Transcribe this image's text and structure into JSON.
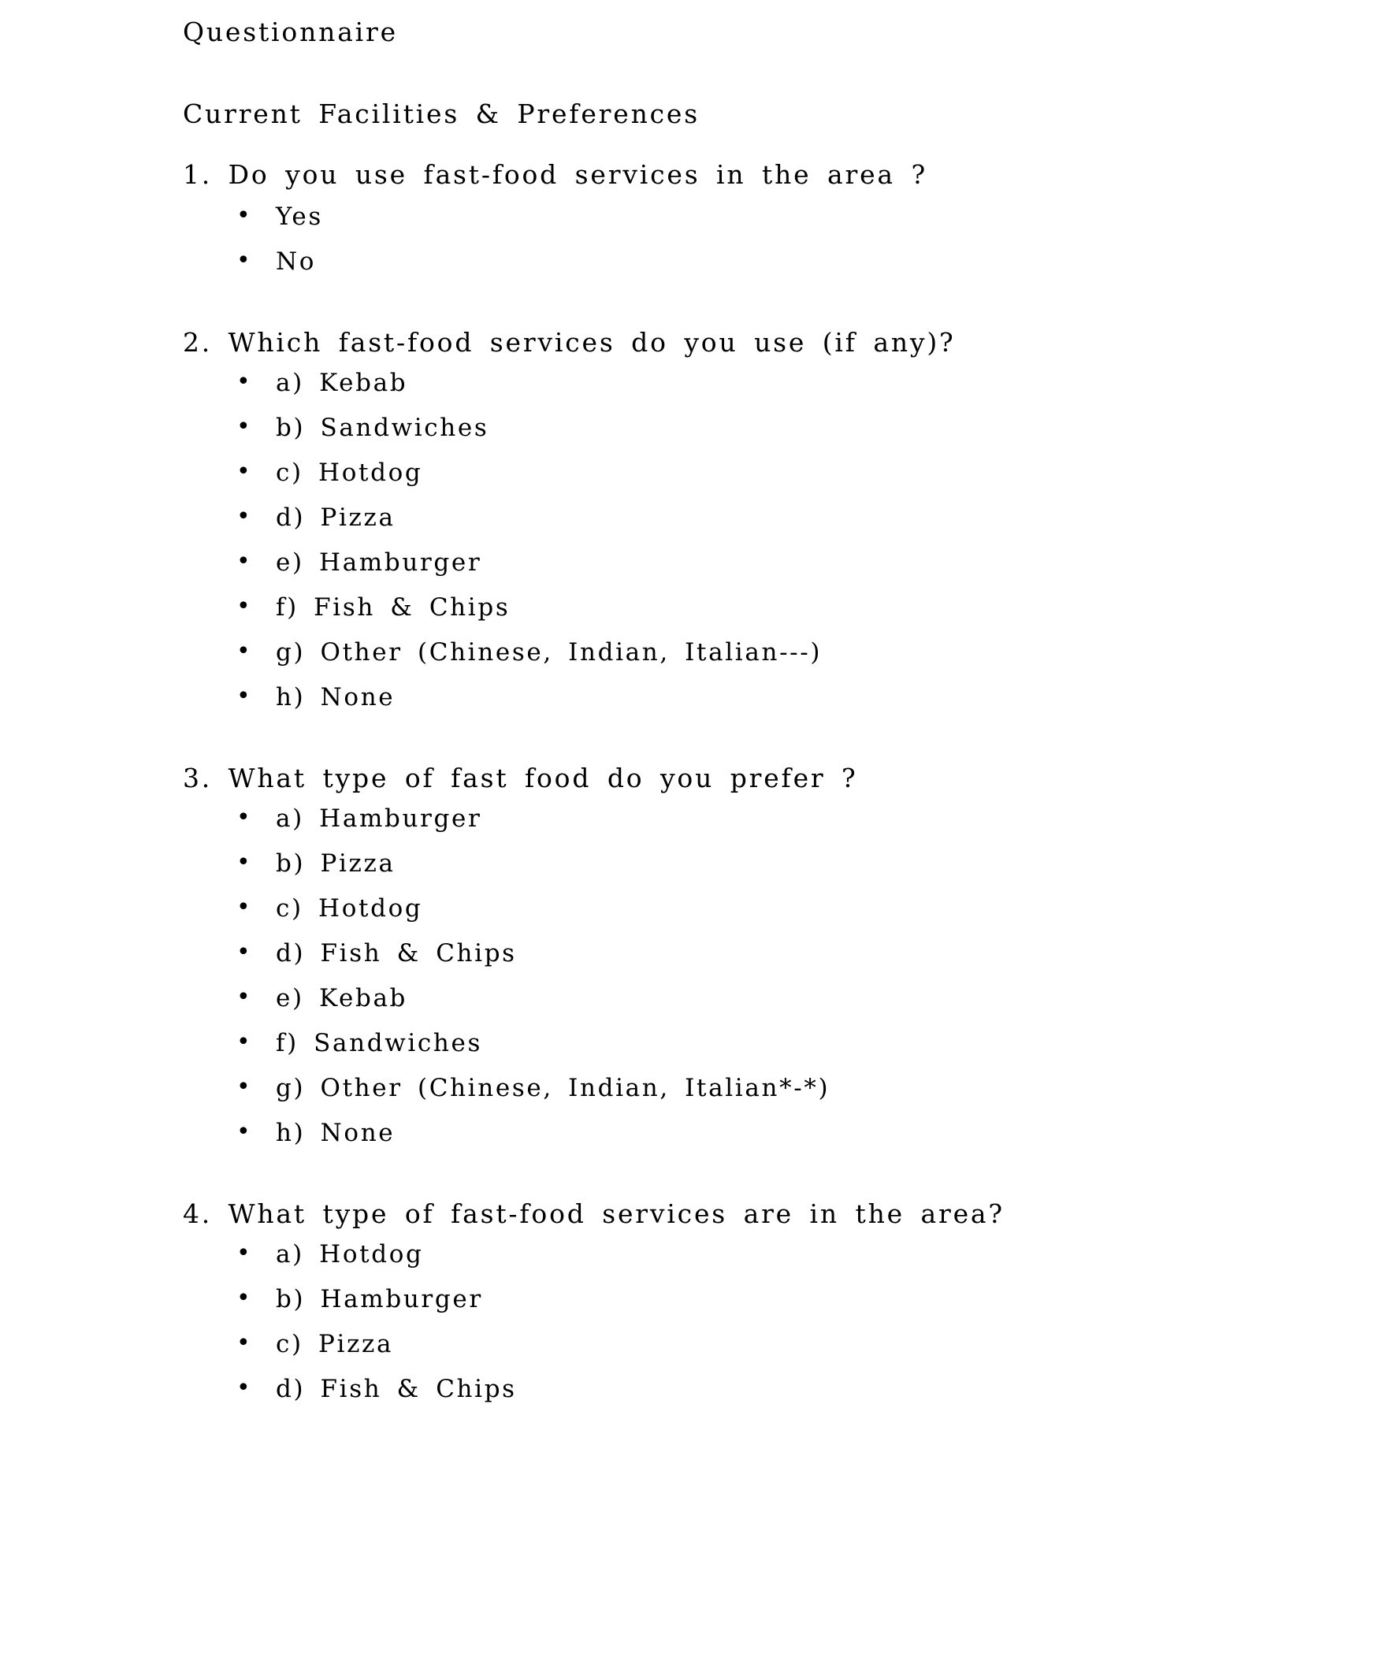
{
  "document": {
    "title": "Questionnaire",
    "section_heading": "Current Facilities & Preferences",
    "bullet_glyph": "•",
    "text_color": "#000000",
    "background_color": "#ffffff"
  },
  "questions": [
    {
      "number": "1.",
      "text": "1. Do you use fast-food services in the area ?",
      "options": [
        {
          "label": "Yes"
        },
        {
          "label": "No"
        }
      ]
    },
    {
      "number": "2.",
      "text": "2. Which fast-food services do you use (if any)?",
      "options": [
        {
          "label": "a) Kebab"
        },
        {
          "label": "b) Sandwiches"
        },
        {
          "label": "c) Hotdog"
        },
        {
          "label": "d) Pizza"
        },
        {
          "label": "e) Hamburger"
        },
        {
          "label": "f) Fish & Chips"
        },
        {
          "label": "g) Other (Chinese, Indian, Italian---)"
        },
        {
          "label": "h) None"
        }
      ]
    },
    {
      "number": "3.",
      "text": "3. What type of fast food do you prefer ?",
      "options": [
        {
          "label": "a) Hamburger"
        },
        {
          "label": "b) Pizza"
        },
        {
          "label": "c) Hotdog"
        },
        {
          "label": "d) Fish & Chips"
        },
        {
          "label": "e) Kebab"
        },
        {
          "label": "f) Sandwiches"
        },
        {
          "label": "g) Other (Chinese, Indian, Italian*-*)"
        },
        {
          "label": "h) None"
        }
      ]
    },
    {
      "number": "4.",
      "text": "4. What type of fast-food services are in the area?",
      "options": [
        {
          "label": "a) Hotdog"
        },
        {
          "label": "b) Hamburger"
        },
        {
          "label": "c) Pizza"
        },
        {
          "label": "d) Fish & Chips"
        }
      ]
    }
  ]
}
